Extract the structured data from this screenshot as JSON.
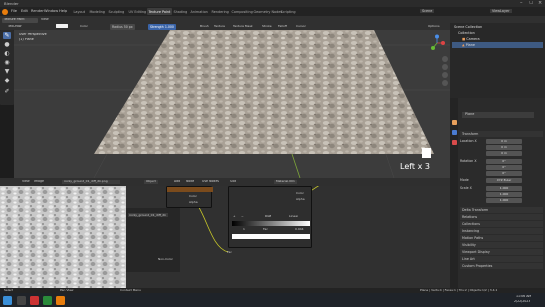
{
  "window": {
    "title": "Blender"
  },
  "menu": {
    "items": [
      "File",
      "Edit",
      "Render",
      "Window",
      "Help"
    ],
    "tabs": [
      "Layout",
      "Modeling",
      "Sculpting",
      "UV Editing",
      "Texture Paint",
      "Shading",
      "Animation",
      "Rendering",
      "Compositing",
      "Geometry Nodes",
      "Scripting"
    ],
    "active_tab": "Texture Paint",
    "scene": "Scene",
    "view_layer": "ViewLayer"
  },
  "header": {
    "mode": "Texture Paint",
    "view": "View",
    "brush": "TexDraw",
    "color_label": "Color",
    "radius_label": "Radius",
    "radius_value": "50 px",
    "strength_label": "Strength",
    "strength_value": "1.000",
    "brush_menu": "Brush",
    "texture_menu": "Texture",
    "texture_mask_menu": "Texture Mask",
    "stroke_menu": "Stroke",
    "falloff_menu": "Falloff",
    "cursor_menu": "Cursor",
    "options": "Options"
  },
  "viewport": {
    "perspective": "User Perspective",
    "object": "(1) Plane",
    "overlay_text": "Left x 3"
  },
  "outliner": {
    "title": "Scene Collection",
    "items": [
      {
        "label": "Collection",
        "indent": 1
      },
      {
        "label": "Camera",
        "indent": 2
      },
      {
        "label": "Plane",
        "indent": 2
      }
    ]
  },
  "properties": {
    "object_name": "Plane",
    "section_transform": "Transform",
    "location_label": "Location X",
    "location": [
      "0 m",
      "0 m",
      "0 m"
    ],
    "rotation_label": "Rotation X",
    "rotation": [
      "0°",
      "0°",
      "0°"
    ],
    "mode_label": "Mode",
    "mode_value": "XYZ Euler",
    "scale_label": "Scale X",
    "scale": [
      "1.000",
      "1.000",
      "1.000"
    ],
    "sections": [
      "Delta Transform",
      "Relations",
      "Collections",
      "Instancing",
      "Motion Paths",
      "Visibility",
      "Viewport Display",
      "Line Art",
      "Custom Properties"
    ]
  },
  "node_editor": {
    "header_items": [
      "View",
      "Image",
      "rocky_ground_01_diff_2k.png",
      "Object",
      "Add",
      "Node",
      "Use Nodes",
      "Slot",
      "Material.001"
    ],
    "sidebar_items": [
      "Image",
      "Non-Color"
    ],
    "node_title": "rocky_ground_01_diff_2k",
    "color_label": "Color",
    "alpha_label": "Alpha",
    "mapping_label": "RGB",
    "interp_label": "Linear",
    "fac_label": "Fac",
    "fac_value": "0.944",
    "value_one": "1",
    "out_color": "Color",
    "out_alpha": "Alpha",
    "fac_out": "Fac"
  },
  "statusbar": {
    "left": "Select",
    "mid": "Pan View",
    "right": "Context Menu",
    "version": "Plane | Verts:4 | Faces:1 | Tris:2 | Objects:1/2 | 3.4.1"
  },
  "taskbar": {
    "time": "11:06 AM",
    "date": "2/22/2023"
  }
}
